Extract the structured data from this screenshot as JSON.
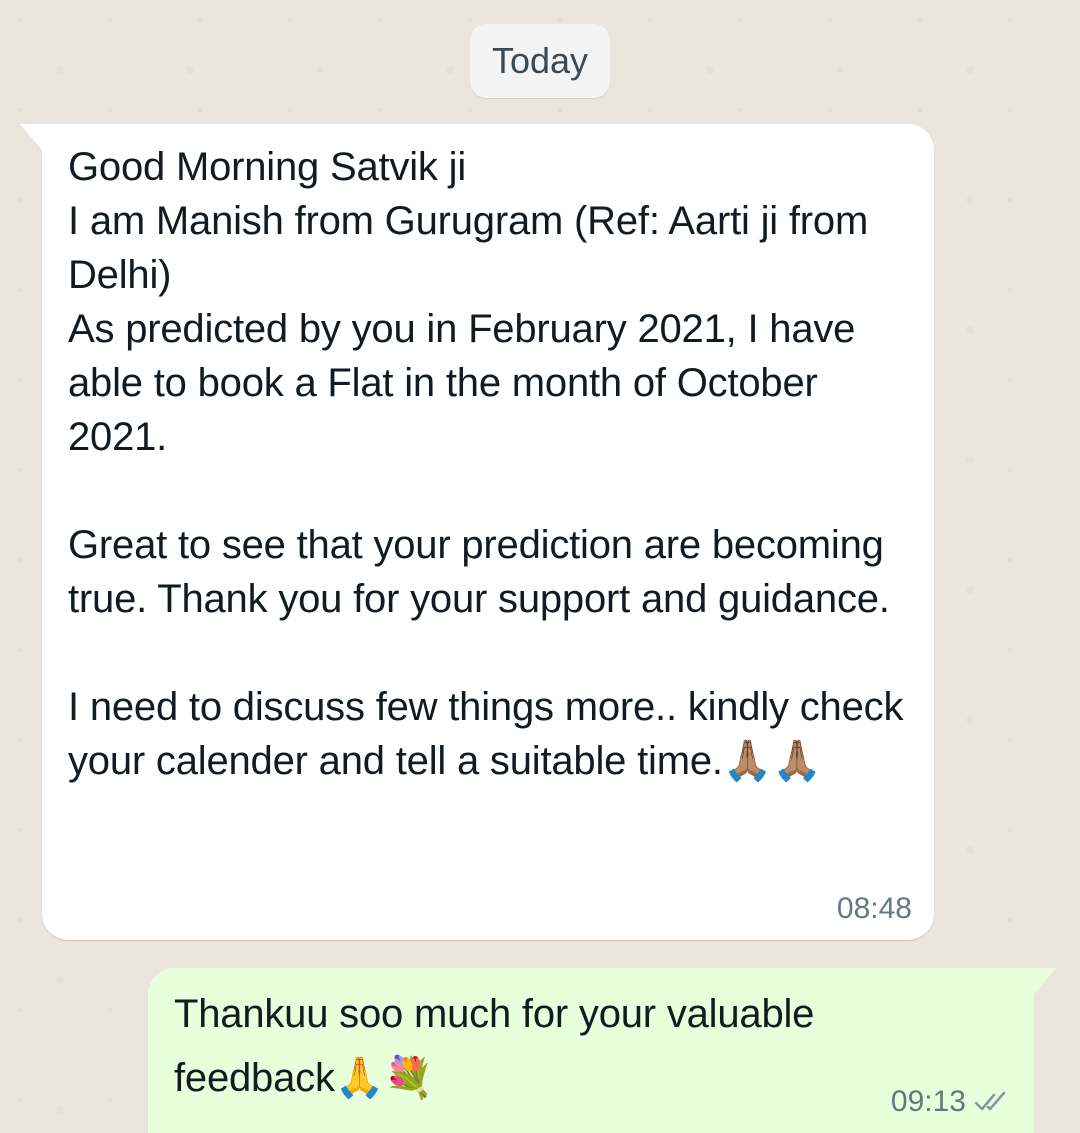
{
  "date_separator": "Today",
  "messages": [
    {
      "direction": "incoming",
      "text": "Good Morning Satvik ji\nI am Manish from Gurugram (Ref: Aarti ji from Delhi)\nAs predicted by you in February 2021, I have able to book a Flat in the month of October 2021.\n\nGreat to see that your prediction are becoming true. Thank you for your support and guidance.\n\nI need to discuss few things more.. kindly check your calender and tell a suitable time.🙏🏽🙏🏽",
      "time": "08:48"
    },
    {
      "direction": "outgoing",
      "text": "Thankuu soo much for your valuable feedback🙏💐",
      "time": "09:13",
      "status_icon": "double-check-icon"
    }
  ],
  "colors": {
    "background": "#ece5dd",
    "incoming_bubble": "#ffffff",
    "outgoing_bubble": "#e7ffdb",
    "timestamp": "#667781",
    "text": "#111b21"
  }
}
